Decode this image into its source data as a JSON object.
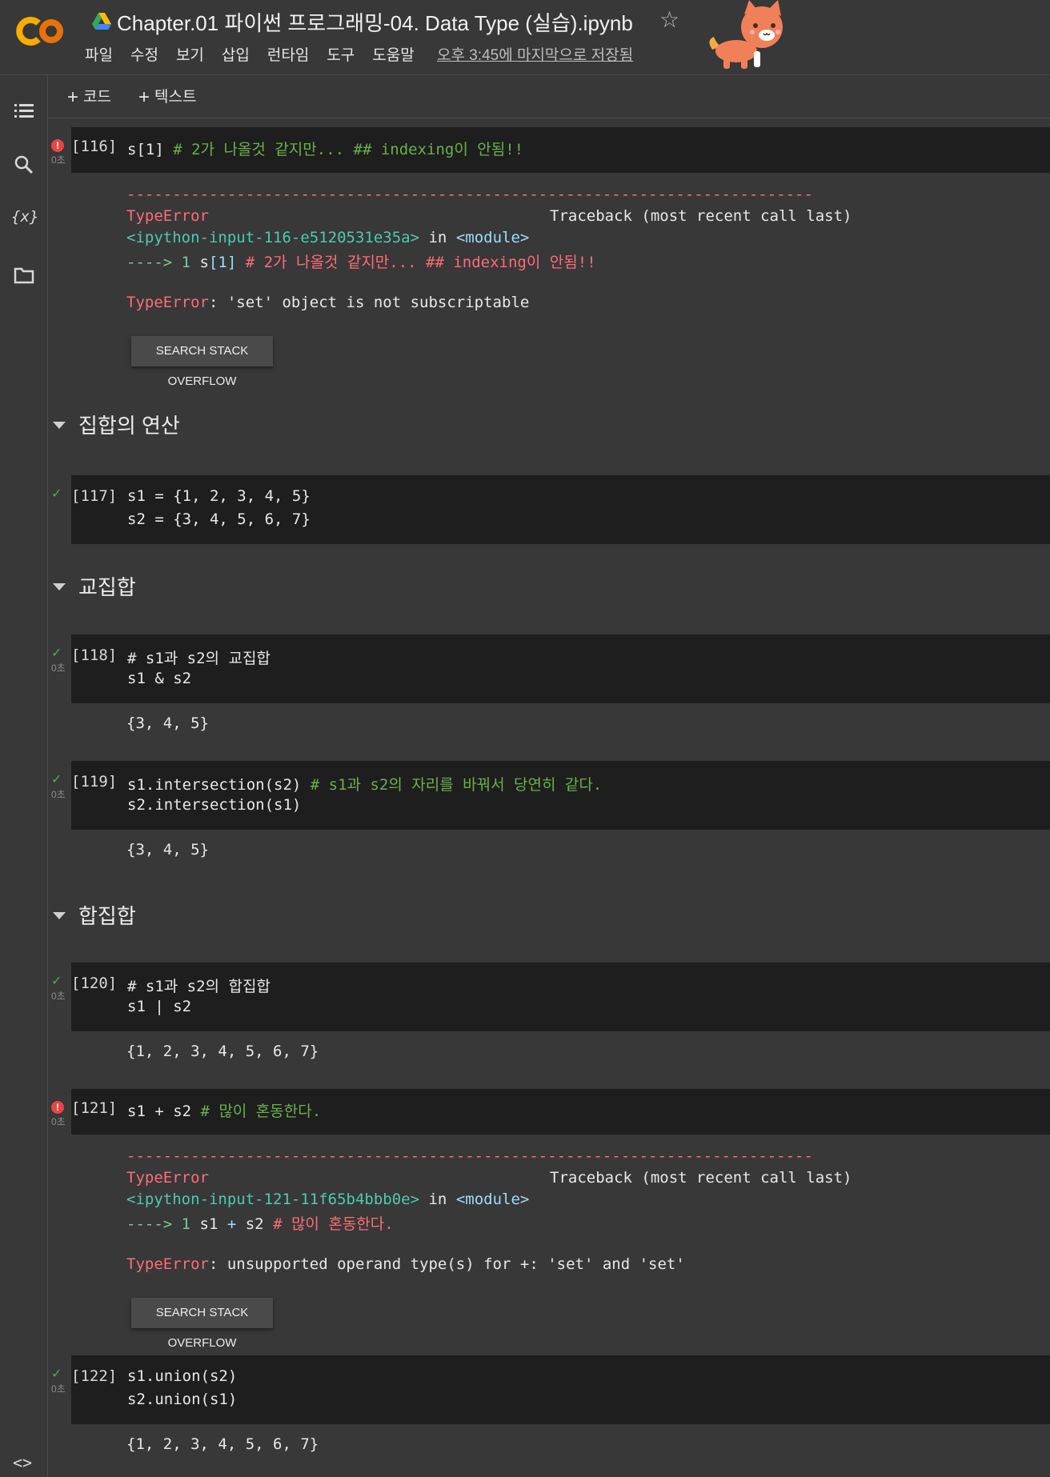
{
  "header": {
    "title": "Chapter.01 파이썬 프로그래밍-04. Data Type (실습).ipynb",
    "menus": [
      "파일",
      "수정",
      "보기",
      "삽입",
      "런타임",
      "도구",
      "도움말"
    ],
    "saved_status": "오후 3:45에 마지막으로 저장됨"
  },
  "toolbar": {
    "add_code": "코드",
    "add_text": "텍스트"
  },
  "colors": {
    "background": "#383838",
    "code_bg": "#1e1e1e",
    "error": "#ff6b78",
    "comment": "#6ab04c",
    "success": "#4caf50"
  },
  "cells": {
    "c116": {
      "exec": "[116]",
      "time": "0초",
      "code_pre": "s[1] ",
      "code_comment": "# 2가 나올것 같지만... ## indexing이 안됨!!",
      "out_dashes": "---------------------------------------------------------------------------",
      "out_err": "TypeError",
      "out_traceback": "Traceback (most recent call last)",
      "out_file": "<ipython-input-116-e5120531e35a>",
      "out_in": " in ",
      "out_module": "<module>",
      "out_arrow": "----> 1 ",
      "out_code_a": "s",
      "out_code_b": "[1]",
      "out_code_comment": " # 2가 나올것 같지만... ## indexing이 안됨!!",
      "out_msg_type": "TypeError",
      "out_msg": ": 'set' object is not subscriptable",
      "so_button": "SEARCH STACK OVERFLOW"
    },
    "h1": "집합의 연산",
    "c117": {
      "exec": "[117]",
      "line1": "s1 = {1, 2, 3, 4, 5}",
      "line2": "s2 = {3, 4, 5, 6, 7}"
    },
    "h2": "교집합",
    "c118": {
      "exec": "[118]",
      "time": "0초",
      "line1": "# s1과 s2의 교집합",
      "line2": "s1 & s2",
      "output": "{3, 4, 5}"
    },
    "c119": {
      "exec": "[119]",
      "time": "0초",
      "line1a": "s1.intersection(s2) ",
      "line1b": "# s1과 s2의 자리를 바꿔서 당연히 같다.",
      "line2": "s2.intersection(s1)",
      "output": "{3, 4, 5}"
    },
    "h3": "합집합",
    "c120": {
      "exec": "[120]",
      "time": "0초",
      "line1": "# s1과 s2의 합집합",
      "line2": "s1 | s2",
      "output": "{1, 2, 3, 4, 5, 6, 7}"
    },
    "c121": {
      "exec": "[121]",
      "time": "0초",
      "code_pre": "s1 + s2 ",
      "code_comment": "# 많이 혼동한다.",
      "out_dashes": "---------------------------------------------------------------------------",
      "out_err": "TypeError",
      "out_traceback": "Traceback (most recent call last)",
      "out_file": "<ipython-input-121-11f65b4bbb0e>",
      "out_in": " in ",
      "out_module": "<module>",
      "out_arrow": "----> 1 ",
      "out_code_a": "s1 ",
      "out_code_op": "+",
      "out_code_c": " s2 ",
      "out_code_comment": "# 많이 혼동한다.",
      "out_msg_type": "TypeError",
      "out_msg": ": unsupported operand type(s) for +: 'set' and 'set'",
      "so_button": "SEARCH STACK OVERFLOW"
    },
    "c122": {
      "exec": "[122]",
      "time": "0초",
      "line1": "s1.union(s2)",
      "line2": "s2.union(s1)",
      "output": "{1, 2, 3, 4, 5, 6, 7}"
    }
  }
}
